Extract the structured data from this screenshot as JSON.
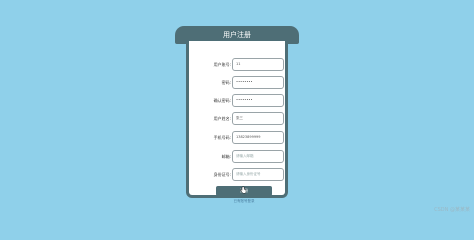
{
  "form": {
    "title": "用户注册",
    "fields": [
      {
        "label": "用户账号:",
        "value": "11",
        "placeholder": ""
      },
      {
        "label": "密码:",
        "value": "••••••••",
        "placeholder": ""
      },
      {
        "label": "确认密码:",
        "value": "••••••••",
        "placeholder": ""
      },
      {
        "label": "用户姓名:",
        "value": "张三",
        "placeholder": ""
      },
      {
        "label": "手机号码:",
        "value": "13823899999",
        "placeholder": ""
      },
      {
        "label": "邮箱:",
        "value": "",
        "placeholder": "请输入邮箱"
      },
      {
        "label": "身份证号:",
        "value": "",
        "placeholder": "请输入身份证号"
      }
    ],
    "submit_label": "注册",
    "link_label": "已有账号登录"
  },
  "watermark": "CSDN @某某某",
  "colors": {
    "background": "#8fd0ea",
    "card_dark": "#4e6e76",
    "card_body": "#ffffff"
  },
  "icons": {
    "cursor": "hand-pointer-icon"
  }
}
